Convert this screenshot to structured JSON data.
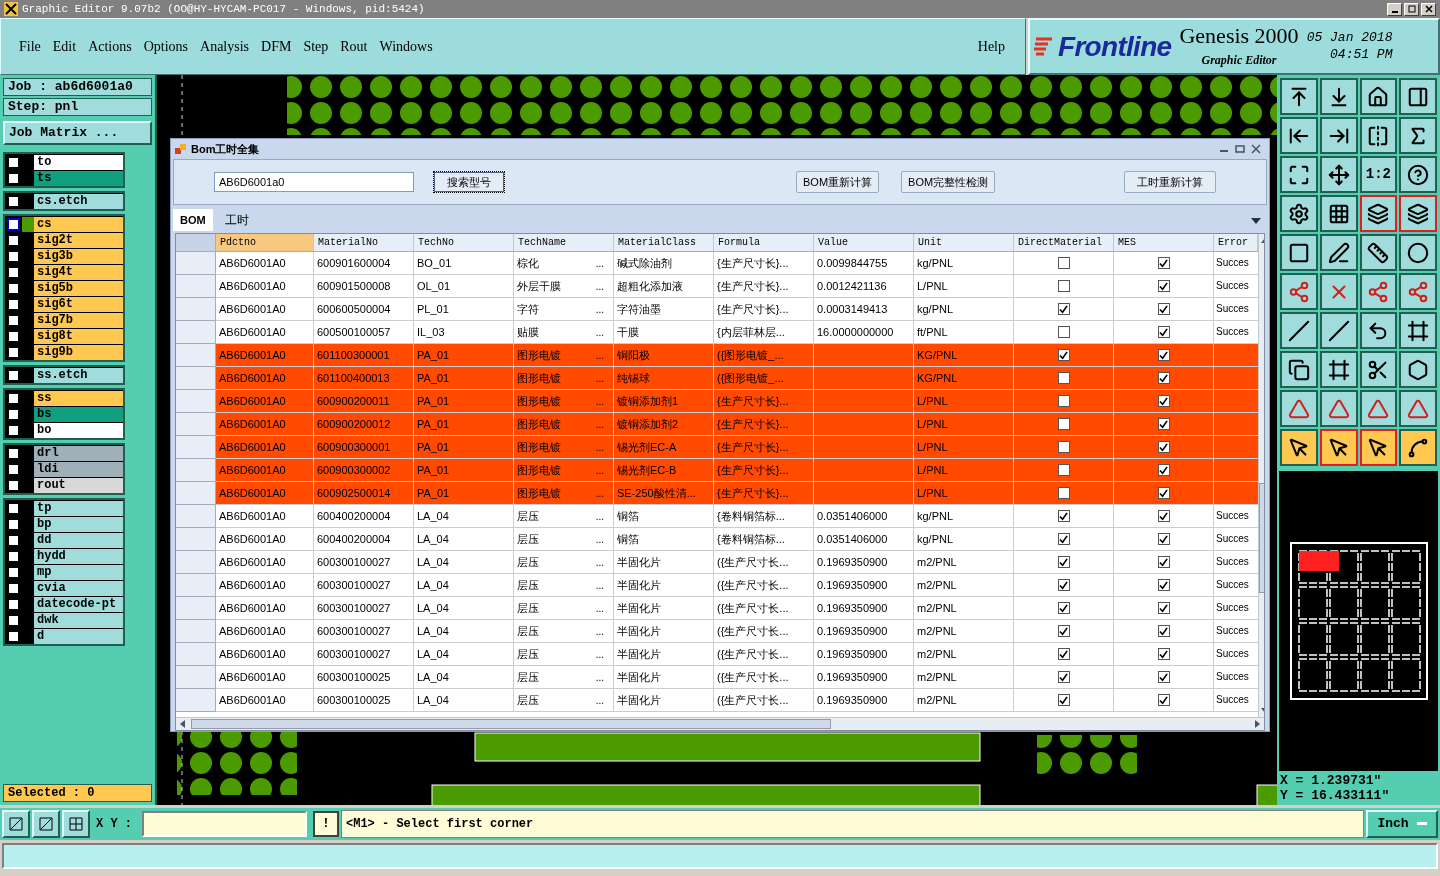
{
  "window": {
    "title": "Graphic Editor 9.07b2 (OO@HY-HYCAM-PC017 - Windows, pid:5424)"
  },
  "menu": [
    "File",
    "Edit",
    "Actions",
    "Options",
    "Analysis",
    "DFM",
    "Step",
    "Rout",
    "Windows"
  ],
  "help": "Help",
  "logo": {
    "brand": "Frontline",
    "product": "Genesis 2000",
    "subtitle": "Graphic Editor",
    "date": "05 Jan 2018",
    "time": "04:51 PM"
  },
  "job": {
    "job": "Job : ab6d6001a0",
    "step": "Step: pnl",
    "matrix_button": "Job Matrix ..."
  },
  "layer_groups": [
    [
      {
        "name": "to",
        "color": "#ffffff",
        "selected": false,
        "checked": false
      },
      {
        "name": "ts",
        "color": "#10a080",
        "selected": false,
        "checked": false
      }
    ],
    [
      {
        "name": "cs.etch",
        "color": "#a0dcdc",
        "selected": false,
        "checked": false
      }
    ],
    [
      {
        "name": "cs",
        "color": "#ffc850",
        "selected": true,
        "checked": false
      },
      {
        "name": "sig2t",
        "color": "#ffc850",
        "selected": false,
        "checked": false
      },
      {
        "name": "sig3b",
        "color": "#ffc850",
        "selected": false,
        "checked": false
      },
      {
        "name": "sig4t",
        "color": "#ffc850",
        "selected": false,
        "checked": false
      },
      {
        "name": "sig5b",
        "color": "#ffc850",
        "selected": false,
        "checked": false
      },
      {
        "name": "sig6t",
        "color": "#ffc850",
        "selected": false,
        "checked": false
      },
      {
        "name": "sig7b",
        "color": "#ffc850",
        "selected": false,
        "checked": false
      },
      {
        "name": "sig8t",
        "color": "#ffc850",
        "selected": false,
        "checked": false
      },
      {
        "name": "sig9b",
        "color": "#ffc850",
        "selected": false,
        "checked": false
      }
    ],
    [
      {
        "name": "ss.etch",
        "color": "#a0dcdc",
        "selected": false,
        "checked": false
      }
    ],
    [
      {
        "name": "ss",
        "color": "#ffc850",
        "selected": false,
        "checked": false
      },
      {
        "name": "bs",
        "color": "#10a080",
        "selected": false,
        "checked": false
      },
      {
        "name": "bo",
        "color": "#ffffff",
        "selected": false,
        "checked": false
      }
    ],
    [
      {
        "name": "drl",
        "color": "#a0b0b8",
        "selected": false,
        "checked": false
      },
      {
        "name": "ldi",
        "color": "#a0b0b8",
        "selected": false,
        "checked": false
      },
      {
        "name": "rout",
        "color": "#d8d8d8",
        "selected": false,
        "checked": false
      }
    ],
    [
      {
        "name": "tp",
        "color": "#a0dcdc",
        "selected": false,
        "checked": false
      },
      {
        "name": "bp",
        "color": "#a0dcdc",
        "selected": false,
        "checked": false
      },
      {
        "name": "dd",
        "color": "#a0dcdc",
        "selected": false,
        "checked": false
      },
      {
        "name": "hydd",
        "color": "#a0dcdc",
        "selected": false,
        "checked": false
      },
      {
        "name": "mp",
        "color": "#a0dcdc",
        "selected": false,
        "checked": false
      },
      {
        "name": "cvia",
        "color": "#a0dcdc",
        "selected": false,
        "checked": false
      },
      {
        "name": "datecode-pt",
        "color": "#a0dcdc",
        "selected": false,
        "checked": false
      },
      {
        "name": "dwk",
        "color": "#a0dcdc",
        "selected": false,
        "checked": false
      },
      {
        "name": "d",
        "color": "#a0dcdc",
        "selected": false,
        "checked": false
      }
    ]
  ],
  "selected_count": "Selected : 0",
  "dialog": {
    "title": "Bom工时全集",
    "search_value": "AB6D6001a0",
    "search_button": "搜索型号",
    "buttons": [
      "BOM重新计算",
      "BOM完整性检测"
    ],
    "right_button": "工时重新计算",
    "tabs": [
      {
        "label": "BOM",
        "selected": true
      },
      {
        "label": "工时",
        "selected": false
      }
    ],
    "table": {
      "columns": [
        "Pdctno",
        "MaterialNo",
        "TechNo",
        "TechName",
        "MaterialClass",
        "Formula",
        "Value",
        "Unit",
        "DirectMaterial",
        "MES",
        "Error"
      ],
      "rows": [
        {
          "highlighted": false,
          "pdctno": "AB6D6001A0",
          "material_no": "600901600004",
          "tech_no": "BO_01",
          "tech_name": "棕化",
          "more": "...",
          "material_class": "碱式除油剂",
          "formula": "{生产尺寸长}...",
          "value": "0.0099844755",
          "unit": "kg/PNL",
          "direct_material": false,
          "mes": true,
          "error": "Succes"
        },
        {
          "highlighted": false,
          "pdctno": "AB6D6001A0",
          "material_no": "600901500008",
          "tech_no": "OL_01",
          "tech_name": "外层干膜",
          "more": "...",
          "material_class": "超粗化添加液",
          "formula": "{生产尺寸长}...",
          "value": "0.0012421136",
          "unit": "L/PNL",
          "direct_material": false,
          "mes": true,
          "error": "Succes"
        },
        {
          "highlighted": false,
          "pdctno": "AB6D6001A0",
          "material_no": "600600500004",
          "tech_no": "PL_01",
          "tech_name": "字符",
          "more": "...",
          "material_class": "字符油墨",
          "formula": "{生产尺寸长}...",
          "value": "0.0003149413",
          "unit": "kg/PNL",
          "direct_material": true,
          "mes": true,
          "error": "Succes"
        },
        {
          "highlighted": false,
          "pdctno": "AB6D6001A0",
          "material_no": "600500100057",
          "tech_no": "IL_03",
          "tech_name": "贴膜",
          "more": "...",
          "material_class": "干膜",
          "formula": "{内层菲林层...",
          "value": "16.0000000000",
          "unit": "ft/PNL",
          "direct_material": false,
          "mes": true,
          "error": "Succes"
        },
        {
          "highlighted": true,
          "pdctno": "AB6D6001A0",
          "material_no": "601100300001",
          "tech_no": "PA_01",
          "tech_name": "图形电镀",
          "more": "...",
          "material_class": "铜阳极",
          "formula": "({图形电镀_...",
          "unit": "KG/PNL",
          "direct_material": true,
          "mes": true
        },
        {
          "highlighted": true,
          "pdctno": "AB6D6001A0",
          "material_no": "601100400013",
          "tech_no": "PA_01",
          "tech_name": "图形电镀",
          "more": "...",
          "material_class": "纯锡球",
          "formula": "({图形电镀_...",
          "unit": "KG/PNL",
          "direct_material": false,
          "mes": true
        },
        {
          "highlighted": true,
          "pdctno": "AB6D6001A0",
          "material_no": "600900200011",
          "tech_no": "PA_01",
          "tech_name": "图形电镀",
          "more": "...",
          "material_class": "镀铜添加剂1",
          "formula": "{生产尺寸长}...",
          "unit": "L/PNL",
          "direct_material": false,
          "mes": true
        },
        {
          "highlighted": true,
          "pdctno": "AB6D6001A0",
          "material_no": "600900200012",
          "tech_no": "PA_01",
          "tech_name": "图形电镀",
          "more": "...",
          "material_class": "镀铜添加剂2",
          "formula": "{生产尺寸长}...",
          "unit": "L/PNL",
          "direct_material": false,
          "mes": true
        },
        {
          "highlighted": true,
          "pdctno": "AB6D6001A0",
          "material_no": "600900300001",
          "tech_no": "PA_01",
          "tech_name": "图形电镀",
          "more": "...",
          "material_class": "锡光剂EC-A",
          "formula": "{生产尺寸长}...",
          "unit": "L/PNL",
          "direct_material": false,
          "mes": true
        },
        {
          "highlighted": true,
          "pdctno": "AB6D6001A0",
          "material_no": "600900300002",
          "tech_no": "PA_01",
          "tech_name": "图形电镀",
          "more": "...",
          "material_class": "锡光剂EC-B",
          "formula": "{生产尺寸长}...",
          "unit": "L/PNL",
          "direct_material": false,
          "mes": true
        },
        {
          "highlighted": true,
          "pdctno": "AB6D6001A0",
          "material_no": "600902500014",
          "tech_no": "PA_01",
          "tech_name": "图形电镀",
          "more": "...",
          "material_class": "SE-250酸性清...",
          "formula": "{生产尺寸长}...",
          "unit": "L/PNL",
          "direct_material": false,
          "mes": true
        },
        {
          "highlighted": false,
          "pdctno": "AB6D6001A0",
          "material_no": "600400200004",
          "tech_no": "LA_04",
          "tech_name": "层压",
          "more": "...",
          "material_class": "铜箔",
          "formula": "{卷料铜箔标...",
          "value": "0.0351406000",
          "unit": "kg/PNL",
          "direct_material": true,
          "mes": true,
          "error": "Succes"
        },
        {
          "highlighted": false,
          "pdctno": "AB6D6001A0",
          "material_no": "600400200004",
          "tech_no": "LA_04",
          "tech_name": "层压",
          "more": "...",
          "material_class": "铜箔",
          "formula": "{卷料铜箔标...",
          "value": "0.0351406000",
          "unit": "kg/PNL",
          "direct_material": true,
          "mes": true,
          "error": "Succes"
        },
        {
          "highlighted": false,
          "pdctno": "AB6D6001A0",
          "material_no": "600300100027",
          "tech_no": "LA_04",
          "tech_name": "层压",
          "more": "...",
          "material_class": "半固化片",
          "formula": "({生产尺寸长...",
          "value": "0.1969350900",
          "unit": "m2/PNL",
          "direct_material": true,
          "mes": true,
          "error": "Succes"
        },
        {
          "highlighted": false,
          "pdctno": "AB6D6001A0",
          "material_no": "600300100027",
          "tech_no": "LA_04",
          "tech_name": "层压",
          "more": "...",
          "material_class": "半固化片",
          "formula": "({生产尺寸长...",
          "value": "0.1969350900",
          "unit": "m2/PNL",
          "direct_material": true,
          "mes": true,
          "error": "Succes"
        },
        {
          "highlighted": false,
          "pdctno": "AB6D6001A0",
          "material_no": "600300100027",
          "tech_no": "LA_04",
          "tech_name": "层压",
          "more": "...",
          "material_class": "半固化片",
          "formula": "({生产尺寸长...",
          "value": "0.1969350900",
          "unit": "m2/PNL",
          "direct_material": true,
          "mes": true,
          "error": "Succes"
        },
        {
          "highlighted": false,
          "pdctno": "AB6D6001A0",
          "material_no": "600300100027",
          "tech_no": "LA_04",
          "tech_name": "层压",
          "more": "...",
          "material_class": "半固化片",
          "formula": "({生产尺寸长...",
          "value": "0.1969350900",
          "unit": "m2/PNL",
          "direct_material": true,
          "mes": true,
          "error": "Succes"
        },
        {
          "highlighted": false,
          "pdctno": "AB6D6001A0",
          "material_no": "600300100027",
          "tech_no": "LA_04",
          "tech_name": "层压",
          "more": "...",
          "material_class": "半固化片",
          "formula": "({生产尺寸长...",
          "value": "0.1969350900",
          "unit": "m2/PNL",
          "direct_material": true,
          "mes": true,
          "error": "Succes"
        },
        {
          "highlighted": false,
          "pdctno": "AB6D6001A0",
          "material_no": "600300100025",
          "tech_no": "LA_04",
          "tech_name": "层压",
          "more": "...",
          "material_class": "半固化片",
          "formula": "({生产尺寸长...",
          "value": "0.1969350900",
          "unit": "m2/PNL",
          "direct_material": true,
          "mes": true,
          "error": "Succes"
        },
        {
          "highlighted": false,
          "pdctno": "AB6D6001A0",
          "material_no": "600300100025",
          "tech_no": "LA_04",
          "tech_name": "层压",
          "more": "...",
          "material_class": "半固化片",
          "formula": "({生产尺寸长...",
          "value": "0.1969350900",
          "unit": "m2/PNL",
          "direct_material": true,
          "mes": true,
          "error": "Succes"
        }
      ]
    }
  },
  "toolbar": [
    {
      "highlighted": false,
      "buttons": [
        {
          "selected": false
        },
        {
          "selected": false
        },
        {
          "selected": false
        },
        {
          "selected": false
        }
      ]
    },
    {
      "highlighted": false,
      "buttons": [
        {
          "selected": false
        },
        {
          "selected": false
        },
        {
          "selected": false
        },
        {
          "selected": false
        }
      ]
    },
    {
      "highlighted": false,
      "buttons": [
        {
          "selected": false
        },
        {
          "selected": false
        },
        {
          "selected": false,
          "label": "1:2"
        },
        {
          "selected": false
        }
      ]
    },
    {
      "highlighted": false,
      "buttons": [
        {
          "selected": false
        },
        {
          "selected": false
        },
        {
          "selected": true
        },
        {
          "selected": true
        }
      ]
    },
    {
      "highlighted": false,
      "buttons": [
        {
          "selected": false
        },
        {
          "selected": false
        },
        {
          "selected": false
        },
        {
          "selected": false
        }
      ]
    },
    {
      "highlighted": false,
      "buttons": [
        {
          "selected": false
        },
        {
          "selected": false
        },
        {
          "selected": false
        },
        {
          "selected": false
        }
      ]
    },
    {
      "highlighted": false,
      "buttons": [
        {
          "selected": false
        },
        {
          "selected": false
        },
        {
          "selected": false
        },
        {
          "selected": false
        }
      ]
    },
    {
      "highlighted": false,
      "buttons": [
        {
          "selected": false
        },
        {
          "selected": false
        },
        {
          "selected": false
        },
        {
          "selected": false
        }
      ]
    },
    {
      "highlighted": false,
      "buttons": [
        {
          "selected": false
        },
        {
          "selected": false
        },
        {
          "selected": false
        },
        {
          "selected": false
        }
      ]
    },
    {
      "highlighted": true,
      "buttons": [
        {
          "selected": false
        },
        {
          "selected": true
        },
        {
          "selected": true
        },
        {
          "selected": false
        }
      ]
    }
  ],
  "coordinates": {
    "x": "X = 1.239731\"",
    "y": "Y = 16.433111\""
  },
  "bottom": {
    "xy_label": "X Y :",
    "alert_button": "!",
    "message": "<M1> - Select first corner",
    "units": "Inch"
  }
}
